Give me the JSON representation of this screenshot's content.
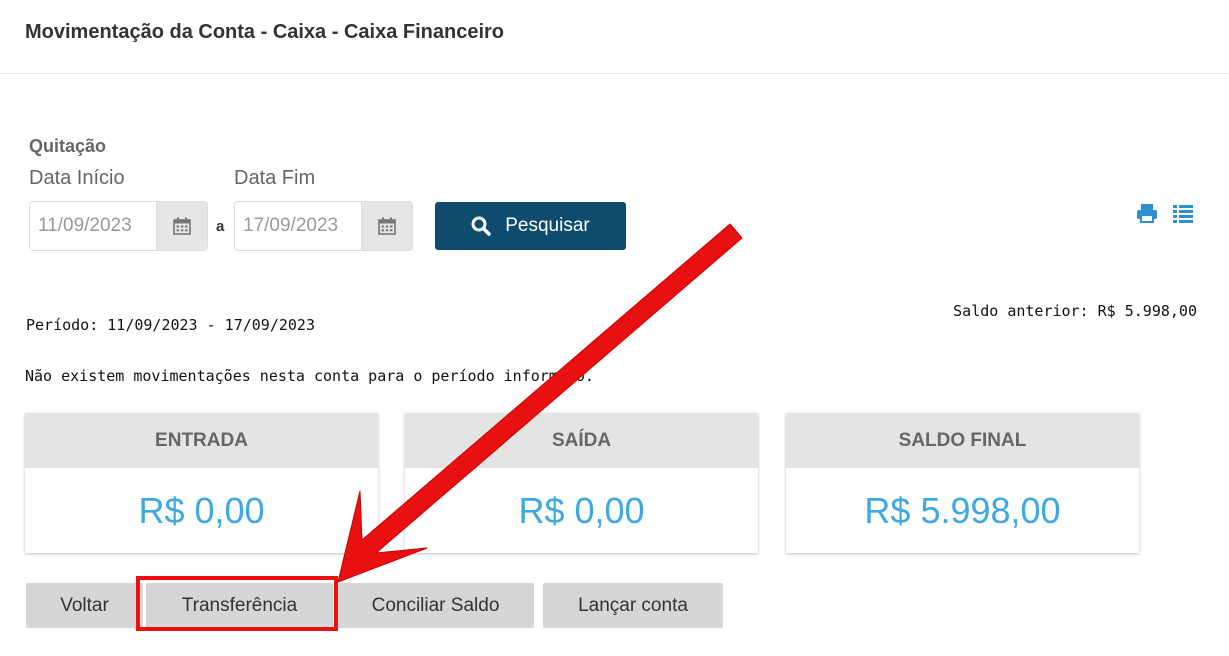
{
  "header": {
    "title": "Movimentação da Conta - Caixa - Caixa Financeiro"
  },
  "filters": {
    "section_label": "Quitação",
    "start_label": "Data Início",
    "end_label": "Data Fim",
    "start_value": "11/09/2023",
    "end_value": "17/09/2023",
    "separator": "a",
    "search_label": "Pesquisar"
  },
  "toolbar": {
    "print_icon": "print-icon",
    "list_icon": "list-icon"
  },
  "summary": {
    "saldo_anterior": "Saldo anterior: R$ 5.998,00",
    "periodo": "Período: 11/09/2023 - 17/09/2023",
    "empty_message": "Não existem movimentações nesta conta para o período informado."
  },
  "cards": [
    {
      "title": "ENTRADA",
      "value": "R$ 0,00"
    },
    {
      "title": "SAÍDA",
      "value": "R$ 0,00"
    },
    {
      "title": "SALDO FINAL",
      "value": "R$ 5.998,00"
    }
  ],
  "actions": {
    "voltar": "Voltar",
    "transferencia": "Transferência",
    "conciliar": "Conciliar Saldo",
    "lancar": "Lançar conta"
  },
  "colors": {
    "accent": "#0f4b6e",
    "value_blue": "#3da9e0",
    "annotation_red": "#e81010"
  }
}
